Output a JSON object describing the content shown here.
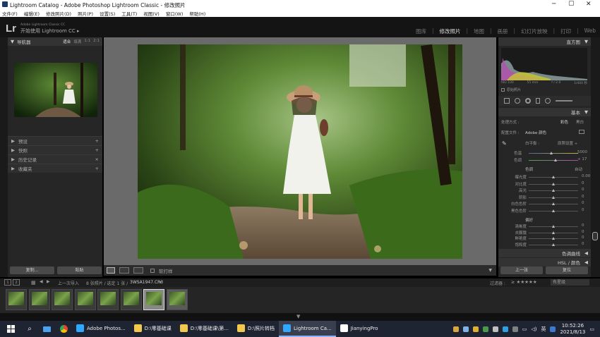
{
  "window": {
    "title": "Lightroom Catalog - Adobe Photoshop Lightroom Classic - 修改照片",
    "minimize": "─",
    "maximize": "▢",
    "close": "✕"
  },
  "menu": [
    "文件(F)",
    "编辑(E)",
    "修改照片(D)",
    "照片(P)",
    "设置(S)",
    "工具(T)",
    "视图(V)",
    "窗口(W)",
    "帮助(H)"
  ],
  "identity": {
    "logo": "Lr",
    "small_text": "Adobe Lightroom Classic CC",
    "main_text": "开始使用 Lightroom CC",
    "arrow": "▸"
  },
  "modules": [
    "图库",
    "修改照片",
    "地图",
    "画册",
    "幻灯片放映",
    "打印",
    "Web"
  ],
  "active_module": "修改照片",
  "left_panel": {
    "navigator": {
      "title": "导航器",
      "zoom_options": [
        "适合",
        "填满",
        "1:1",
        "2:1"
      ]
    },
    "sections": [
      {
        "label": "预设",
        "plus": "+"
      },
      {
        "label": "快照",
        "plus": "+"
      },
      {
        "label": "历史记录",
        "plus": "×"
      },
      {
        "label": "收藏夹",
        "plus": "+"
      }
    ],
    "copy_button": "复制...",
    "paste_button": "粘贴"
  },
  "toolbar": {
    "soft_proof": "软打样"
  },
  "right_panel": {
    "histogram_title": "直方图",
    "histogram_info": [
      "ISO 100",
      "55 mm",
      "f / 2.0",
      "1/400 秒"
    ],
    "original_photo": "原始照片",
    "basic_title": "基本",
    "treatment_label": "处理方式 :",
    "treatment_color": "彩色",
    "treatment_bw": "黑白",
    "profile_label": "配置文件 :",
    "profile_value": "Adobe 颜色",
    "wb_label": "白平衡 :",
    "wb_value": "原照设置 ÷",
    "temp_label": "色温",
    "temp_value": "5000",
    "tint_label": "色调",
    "tint_value": "+ 17",
    "tone_label": "色调",
    "tone_auto": "自动",
    "tone_sliders": [
      {
        "label": "曝光度",
        "value": "0.00"
      },
      {
        "label": "对比度",
        "value": "0"
      },
      {
        "label": "高光",
        "value": "0"
      },
      {
        "label": "阴影",
        "value": "0"
      },
      {
        "label": "白色色阶",
        "value": "0"
      },
      {
        "label": "黑色色阶",
        "value": "0"
      }
    ],
    "presence_label": "偏好",
    "presence_sliders": [
      {
        "label": "清晰度",
        "value": "0"
      },
      {
        "label": "去朦胧",
        "value": "0"
      },
      {
        "label": "鲜艳度",
        "value": "0"
      },
      {
        "label": "饱和度",
        "value": "0"
      }
    ],
    "tone_curve": "色调曲线",
    "hsl": "HSL / 颜色",
    "prev_button": "上一张",
    "reset_button": "复位"
  },
  "filmstrip": {
    "page1": "1",
    "page2": "2",
    "source": "上一次导入",
    "info": "8 张照片 / 选定 1 张 / ",
    "filename": "3WSA1947.CR3",
    "arrow": "▾",
    "filter_label": "过滤器 :",
    "stars": "≥ ★★★★★",
    "filter_value": "有星级",
    "thumb_count": 8
  },
  "taskbar": {
    "apps": [
      {
        "label": "Adobe Photos...",
        "color": "#31a8ff",
        "active": false
      },
      {
        "label": "D:\\零基础课",
        "color": "#f2c94c",
        "active": false
      },
      {
        "label": "D:\\零基础课\\第...",
        "color": "#f2c94c",
        "active": false
      },
      {
        "label": "D:\\照片转档",
        "color": "#f2c94c",
        "active": false
      },
      {
        "label": "Lightroom Ca...",
        "color": "#31a8ff",
        "active": true
      },
      {
        "label": "JianyingPro",
        "color": "#ffffff",
        "active": false
      }
    ],
    "ime": "英",
    "time": "10:52:26",
    "date": "2021/8/13"
  }
}
